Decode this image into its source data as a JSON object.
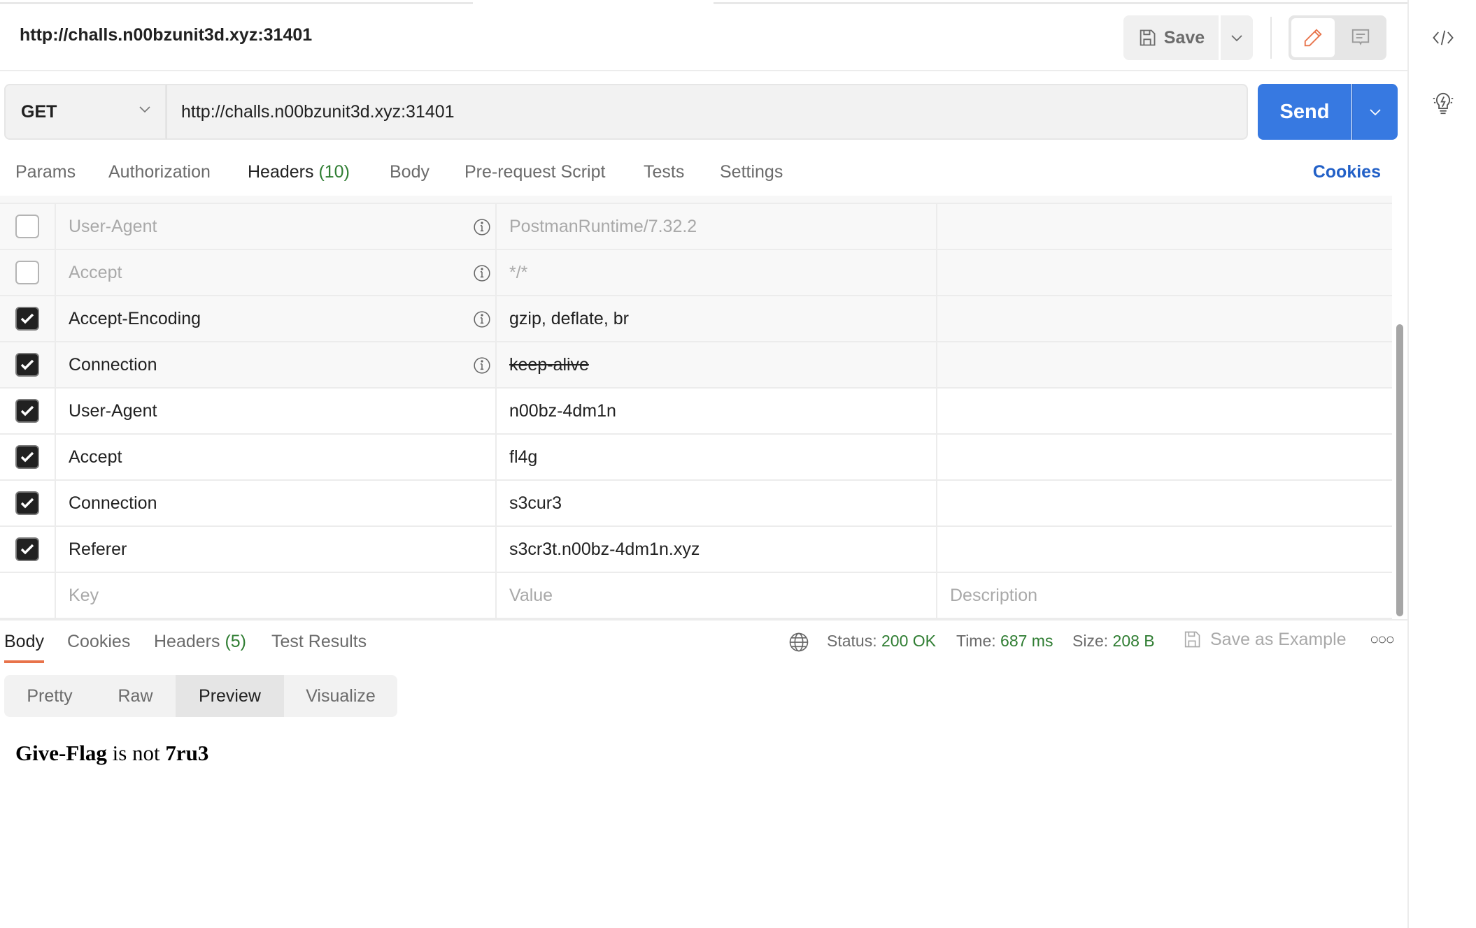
{
  "request": {
    "title": "http://challs.n00bzunit3d.xyz:31401",
    "method": "GET",
    "url": "http://challs.n00bzunit3d.xyz:31401",
    "save_label": "Save",
    "send_label": "Send"
  },
  "request_tabs": [
    {
      "label": "Params",
      "count": null
    },
    {
      "label": "Authorization",
      "count": null
    },
    {
      "label": "Headers",
      "count": "(10)",
      "active": true
    },
    {
      "label": "Body",
      "count": null
    },
    {
      "label": "Pre-request Script",
      "count": null
    },
    {
      "label": "Tests",
      "count": null
    },
    {
      "label": "Settings",
      "count": null
    }
  ],
  "cookies_link": "Cookies",
  "headers": [
    {
      "key": "User-Agent",
      "value": "PostmanRuntime/7.32.2",
      "checked": false,
      "auto": true,
      "overridden": false
    },
    {
      "key": "Accept",
      "value": "*/*",
      "checked": false,
      "auto": true,
      "overridden": false
    },
    {
      "key": "Accept-Encoding",
      "value": "gzip, deflate, br",
      "checked": true,
      "auto": true,
      "overridden": false
    },
    {
      "key": "Connection",
      "value": "keep-alive",
      "checked": true,
      "auto": true,
      "overridden": true
    },
    {
      "key": "User-Agent",
      "value": "n00bz-4dm1n",
      "checked": true,
      "auto": false,
      "overridden": false
    },
    {
      "key": "Accept",
      "value": "fl4g",
      "checked": true,
      "auto": false,
      "overridden": false
    },
    {
      "key": "Connection",
      "value": "s3cur3",
      "checked": true,
      "auto": false,
      "overridden": false
    },
    {
      "key": "Referer",
      "value": "s3cr3t.n00bz-4dm1n.xyz",
      "checked": true,
      "auto": false,
      "overridden": false
    }
  ],
  "new_row": {
    "key_placeholder": "Key",
    "value_placeholder": "Value",
    "description_placeholder": "Description"
  },
  "response_tabs": [
    {
      "label": "Body",
      "count": null,
      "active": true
    },
    {
      "label": "Cookies",
      "count": null
    },
    {
      "label": "Headers",
      "count": "(5)"
    },
    {
      "label": "Test Results",
      "count": null
    }
  ],
  "response_meta": {
    "status_label": "Status:",
    "status": "200 OK",
    "time_label": "Time:",
    "time": "687 ms",
    "size_label": "Size:",
    "size": "208 B",
    "save_example": "Save as Example"
  },
  "body_views": [
    {
      "label": "Pretty"
    },
    {
      "label": "Raw"
    },
    {
      "label": "Preview",
      "active": true
    },
    {
      "label": "Visualize"
    }
  ],
  "preview": {
    "part1": "Give-Flag",
    "part2": " is not ",
    "part3": "7ru3"
  },
  "colors": {
    "accent": "#e8734a",
    "send": "#3779e1",
    "link": "#2260c7",
    "success": "#2f7d32"
  }
}
